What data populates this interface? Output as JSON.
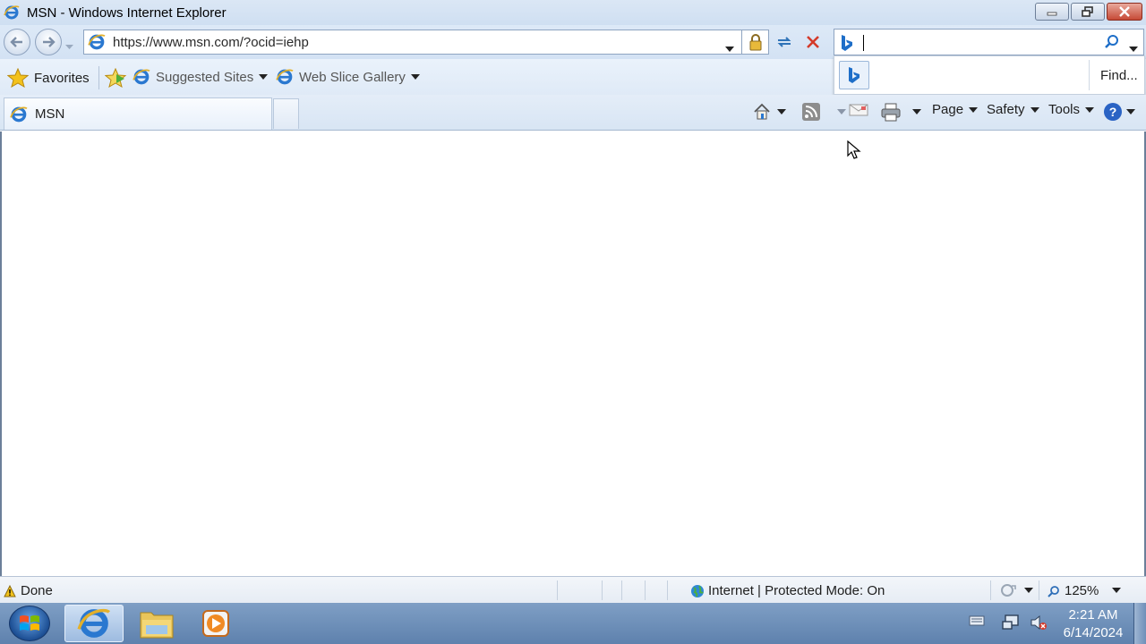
{
  "window": {
    "title": "MSN - Windows Internet Explorer",
    "icons": [
      "ie-icon",
      "minimize-icon",
      "restore-icon",
      "close-icon"
    ]
  },
  "address_bar": {
    "url": "https://www.msn.com/?ocid=iehp"
  },
  "search": {
    "value": "",
    "provider_icon": "bing-icon",
    "popup_find_label": "Find..."
  },
  "favorites_bar": {
    "favorites_label": "Favorites",
    "items": [
      {
        "label": "Suggested Sites",
        "icon": "ie-icon"
      },
      {
        "label": "Web Slice Gallery",
        "icon": "ie-icon"
      }
    ]
  },
  "tabs": [
    {
      "label": "MSN",
      "icon": "ie-icon",
      "active": true
    }
  ],
  "command_bar": {
    "page_label": "Page",
    "safety_label": "Safety",
    "tools_label": "Tools",
    "icons": [
      "home-icon",
      "feeds-icon",
      "mail-icon",
      "print-icon",
      "help-icon"
    ]
  },
  "status_bar": {
    "status": "Done",
    "zone": "Internet | Protected Mode: On",
    "zoom": "125%"
  },
  "taskbar": {
    "apps": [
      "Internet Explorer",
      "Windows Explorer",
      "Windows Media Player"
    ],
    "time": "2:21 AM",
    "date": "6/14/2024"
  },
  "colors": {
    "chrome": "#dbe7f5",
    "accent_blue": "#1e6ec8",
    "stop_red": "#d43a2a",
    "taskbar": "#6f90ba"
  }
}
